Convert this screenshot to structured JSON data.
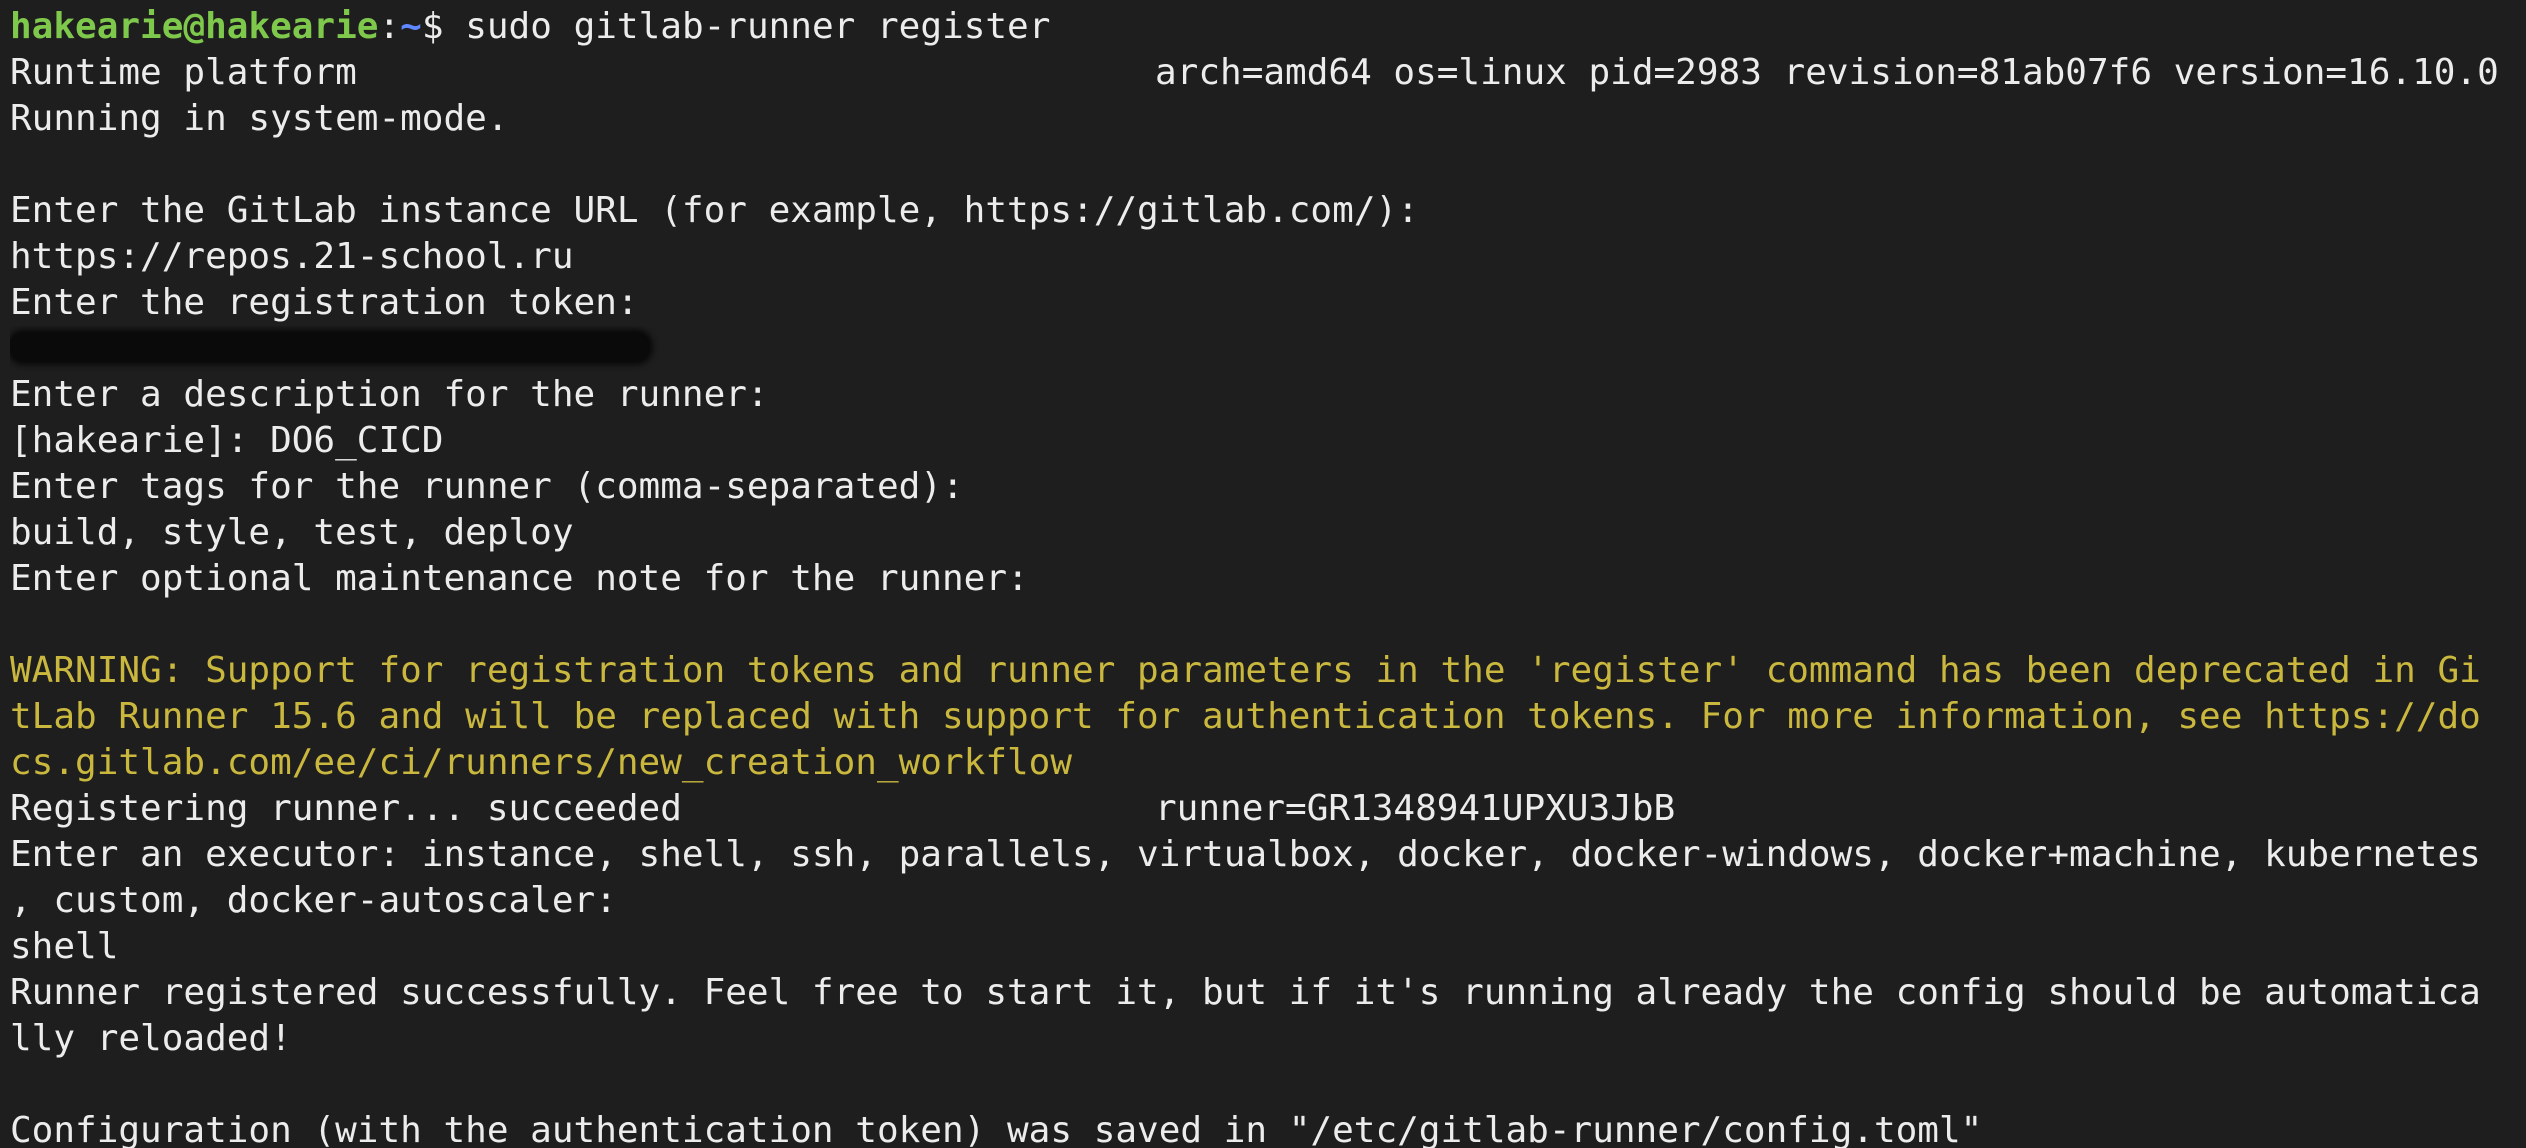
{
  "prompt": {
    "user_host": "hakearie@hakearie",
    "separator": ":",
    "path": "~",
    "symbol": "$ ",
    "command": "sudo gitlab-runner register"
  },
  "lines": {
    "runtime_left": "Runtime platform",
    "runtime_right": "arch=amd64 os=linux pid=2983 revision=81ab07f6 version=16.10.0",
    "system_mode": "Running in system-mode.",
    "url_prompt": "Enter the GitLab instance URL (for example, https://gitlab.com/):",
    "url_value": "https://repos.21-school.ru",
    "token_prompt": "Enter the registration token:",
    "desc_prompt": "Enter a description for the runner:",
    "desc_value": "[hakearie]: DO6_CICD",
    "tags_prompt": "Enter tags for the runner (comma-separated):",
    "tags_value": "build, style, test, deploy",
    "note_prompt": "Enter optional maintenance note for the runner:",
    "warning_1": "WARNING: Support for registration tokens and runner parameters in the 'register' command has been deprecated in Gi",
    "warning_2": "tLab Runner 15.6 and will be replaced with support for authentication tokens. For more information, see https://do",
    "warning_3": "cs.gitlab.com/ee/ci/runners/new_creation_workflow",
    "registering_left": "Registering runner... succeeded",
    "registering_right": "runner=GR1348941UPXU3JbB",
    "executor_1": "Enter an executor: instance, shell, ssh, parallels, virtualbox, docker, docker-windows, docker+machine, kubernetes",
    "executor_2": ", custom, docker-autoscaler:",
    "executor_value": "shell",
    "success_1": "Runner registered successfully. Feel free to start it, but if it's running already the config should be automatica",
    "success_2": "lly reloaded!",
    "config_saved": "Configuration (with the authentication token) was saved in \"/etc/gitlab-runner/config.toml\""
  },
  "colors": {
    "background": "#1e1e1e",
    "text": "#ececec",
    "prompt_user": "#7ec84c",
    "prompt_path": "#5f87ff",
    "warning": "#c9b73e"
  }
}
